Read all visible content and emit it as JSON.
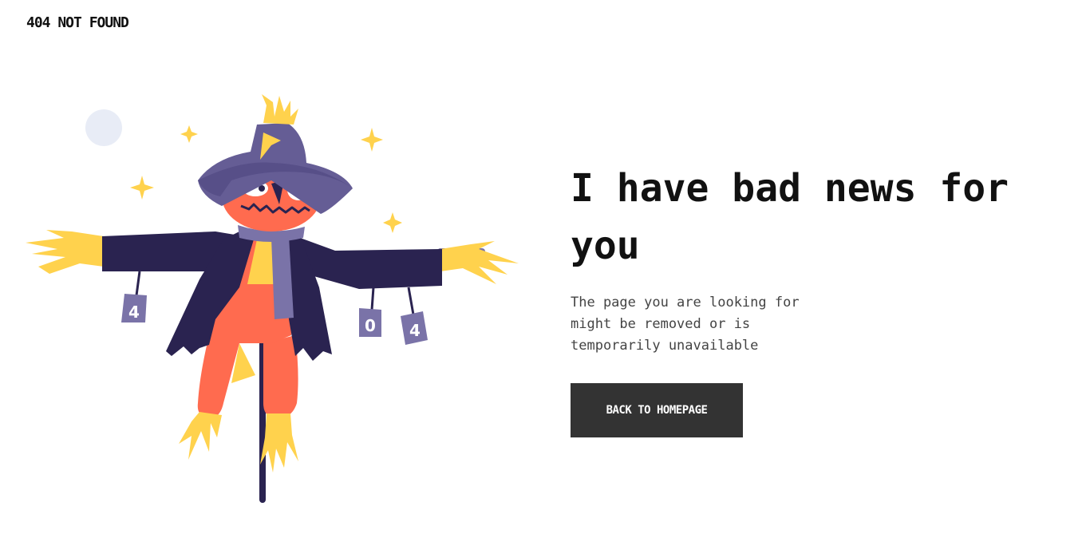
{
  "header": {
    "brand": "404 NOT FOUND"
  },
  "main": {
    "headline": "I have bad news for you",
    "message": "The page you are looking for might be removed or is temporarily unavailable",
    "cta_label": "BACK TO HOMEPAGE"
  },
  "illustration": {
    "subject": "scarecrow",
    "cans": [
      "4",
      "0",
      "4"
    ],
    "colors": {
      "hat": "#655d95",
      "coat": "#2a2350",
      "skin": "#ff6b4f",
      "straw": "#ffd24d",
      "scarf": "#7a73a8",
      "moon": "#e8ecf6"
    }
  },
  "colors": {
    "button_bg": "#333333",
    "button_text": "#ffffff",
    "headline": "#111111",
    "body_text": "#444444"
  }
}
